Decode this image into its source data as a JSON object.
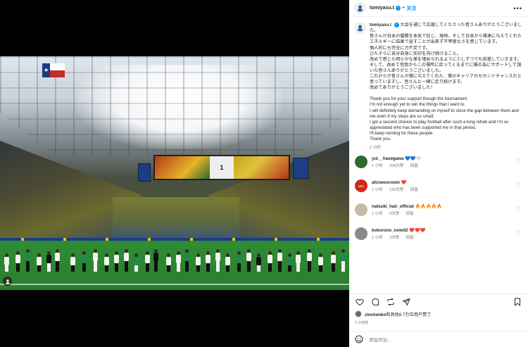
{
  "post": {
    "username": "tomiyasu.t",
    "follow_label": "关注",
    "separator": "•",
    "more": "•••",
    "caption": "大会を通じて応援してくださった皆さんありがとうございました。\n皆さんが日本の優勝を本気で信じ、現地、そして日本から僕達に与えてくれたエネルギーに結果で返すことが出来ず不甲斐なさを感じています。\n個人的にも完全に力不足です。\nひたすらに自分自身に矢印を向け続けること。\n改めて感じた明らかな差を埋められるように少しずつでも前進していきます。\nそして、改めて怪我からこの場所に戻ってくるまでに僕の為にサポートして頂いた皆さんありがとうございました。\nこれからが皆さんが僕に与えてくれた、僕のキャリアのセカンドチャンスだと思っていますし、皆さんと一緒に走り続けます。\n改めてありがとうございました！\n\nThank you for your support though the tournament.\nI'm not enough yet to win the things that I want to.\nI will definitely keep demanding on myself to close the gap between them and me even if my steps are so small.\nI got a second chance to play football after such a long rehab and I'm so appreciated who has been supported me in that period.\nI'll keep running for these people.\nThank you.",
    "caption_time": "1 小时"
  },
  "comments": [
    {
      "user": "yui__hasegawa",
      "emoji": "💙💙🤍",
      "time": "1 小时",
      "likes": "339次赞",
      "reply": "回复",
      "avatar_color": "#2f6a2f"
    },
    {
      "user": "afcnewsroom",
      "emoji": "❤️",
      "time": "1 小时",
      "likes": "133次赞",
      "reply": "回复",
      "avatar_color": "#d0261c",
      "avatar_text": "AFC"
    },
    {
      "user": "natsuki_hair_official",
      "emoji": "🔥🔥🔥🔥🔥",
      "time": "1 小时",
      "likes": "5次赞",
      "reply": "回复",
      "avatar_color": "#c9b9a6"
    },
    {
      "user": "kokorono_note02",
      "emoji": "❤️❤️❤️",
      "time": "1 小时",
      "likes": "2次赞",
      "reply": "回复",
      "avatar_color": "#8a8a8a"
    }
  ],
  "likes": {
    "user": "zinchenko",
    "text": "和其他8.7万位用户赞了"
  },
  "post_time": "2 小时前",
  "add_comment_placeholder": "添加评论...",
  "icons": {
    "like": "heart-icon",
    "comment": "comment-icon",
    "share": "share-icon",
    "save": "bookmark-icon",
    "emoji": "emoji-icon",
    "user_tag": "person-icon"
  },
  "photo": {
    "scoreboard": "1"
  },
  "colors": {
    "accent": "#0095f6",
    "muted": "#737373"
  }
}
